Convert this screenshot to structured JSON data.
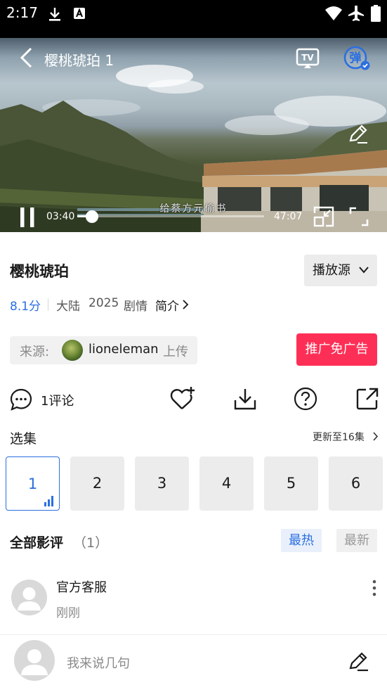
{
  "status_bar": {
    "time": "2:17"
  },
  "player": {
    "title": "樱桃琥珀 1",
    "subtitle_caption": "给蔡方元偷书",
    "current_time": "03:40",
    "duration": "47:07",
    "progress_fraction": 0.078,
    "danmaku_label": "弹",
    "tv_label": "TV"
  },
  "info": {
    "title": "樱桃琥珀",
    "source_button": "播放源",
    "rating": "8.1分",
    "region": "大陆",
    "year": "2025",
    "genre": "剧情",
    "intro_link": "简介",
    "source_label": "来源:",
    "uploader": "lioneleman",
    "uploaded_suffix": "上传",
    "promo_button": "推广免广告"
  },
  "actions": {
    "comments": "1评论"
  },
  "episodes": {
    "title": "选集",
    "update_text": "更新至16集",
    "items": [
      "1",
      "2",
      "3",
      "4",
      "5",
      "6"
    ],
    "active": "1"
  },
  "reviews": {
    "title": "全部影评",
    "count": "（1）",
    "sort_hot": "最热",
    "sort_new": "最新",
    "items": [
      {
        "author": "官方客服",
        "time": "刚刚"
      }
    ]
  },
  "composer": {
    "placeholder": "我来说几句"
  },
  "colors": {
    "accent_blue": "#2b6fe0",
    "promo_red": "#fe2f56",
    "rating_blue": "#2b6fe0"
  }
}
